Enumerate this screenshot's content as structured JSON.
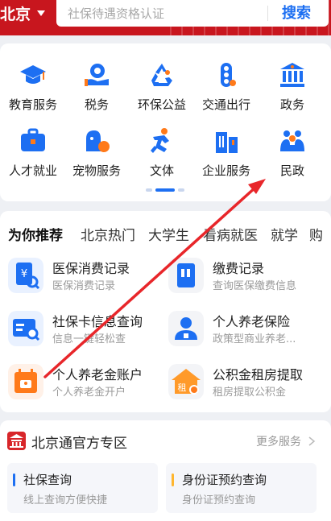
{
  "header": {
    "city": "北京",
    "search_placeholder": "社保待遇资格认证",
    "search_button": "搜索"
  },
  "services": [
    {
      "label": "教育服务",
      "icon": "graduation-cap-icon"
    },
    {
      "label": "税务",
      "icon": "tax-hand-icon"
    },
    {
      "label": "环保公益",
      "icon": "recycle-icon"
    },
    {
      "label": "交通出行",
      "icon": "traffic-light-icon"
    },
    {
      "label": "政务",
      "icon": "government-building-icon"
    },
    {
      "label": "人才就业",
      "icon": "briefcase-icon"
    },
    {
      "label": "宠物服务",
      "icon": "pet-icon"
    },
    {
      "label": "文体",
      "icon": "running-person-icon"
    },
    {
      "label": "企业服务",
      "icon": "office-buildings-icon"
    },
    {
      "label": "民政",
      "icon": "family-icon"
    }
  ],
  "recommend": {
    "tabs": [
      "为你推荐",
      "北京热门",
      "大学生",
      "看病就医",
      "就学",
      "购"
    ],
    "active_tab": "为你推荐",
    "items": [
      {
        "title": "医保消费记录",
        "subtitle": "医保消费记录",
        "icon": "medical-receipt-icon"
      },
      {
        "title": "缴费记录",
        "subtitle": "查询医保缴费信息",
        "icon": "payment-record-icon"
      },
      {
        "title": "社保卡信息查询",
        "subtitle": "信息一键轻松查",
        "icon": "id-card-search-icon"
      },
      {
        "title": "个人养老保险",
        "subtitle": "政策型商业养老...",
        "icon": "person-pension-icon"
      },
      {
        "title": "个人养老金账户",
        "subtitle": "个人养老金开户",
        "icon": "calendar-account-icon"
      },
      {
        "title": "公积金租房提取",
        "subtitle": "租房提取公积金",
        "icon": "house-rent-icon"
      }
    ]
  },
  "zone": {
    "title": "北京通官方专区",
    "more": "更多服务",
    "cards": [
      {
        "title": "社保查询",
        "subtitle": "线上查询方便快捷"
      },
      {
        "title": "身份证预约查询",
        "subtitle": "身份证预约查询"
      }
    ]
  },
  "colors": {
    "brand_red": "#c8161e",
    "blue": "#1d6ff2",
    "orange": "#ff7a1a",
    "annotation_red": "#e8262a"
  }
}
